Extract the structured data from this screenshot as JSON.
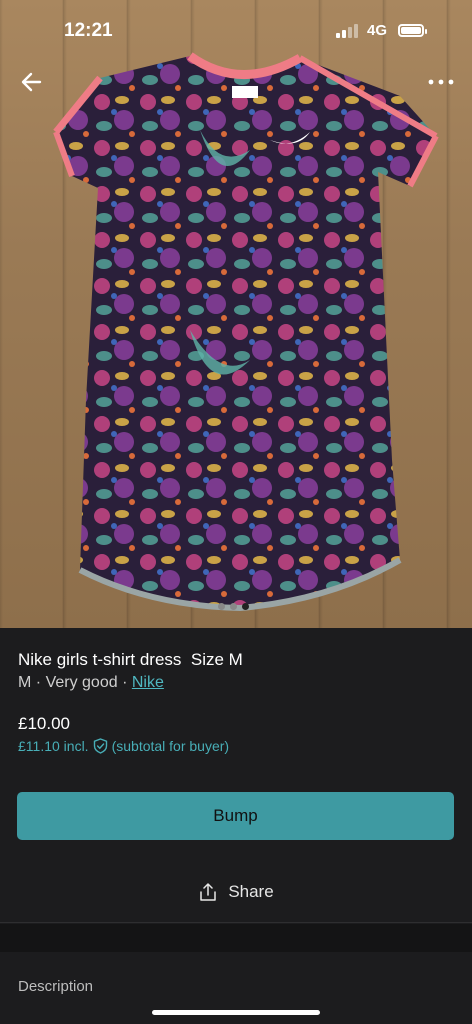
{
  "status_bar": {
    "time": "12:21",
    "network": "4G"
  },
  "photo": {
    "carousel_pages": 3,
    "current_page": 3
  },
  "listing": {
    "title": "Nike girls t-shirt dress  Size M",
    "size": "M",
    "separator": "·",
    "condition": "Very good",
    "brand": "Nike",
    "price": "£10.00",
    "price_incl": "£11.10 incl.",
    "buyer_note": "(subtotal for buyer)"
  },
  "actions": {
    "bump_label": "Bump",
    "share_label": "Share"
  },
  "sections": {
    "description_label": "Description"
  },
  "colors": {
    "accent": "#3e9aa2",
    "link": "#4fb7c0",
    "background": "#1c1c1e"
  }
}
